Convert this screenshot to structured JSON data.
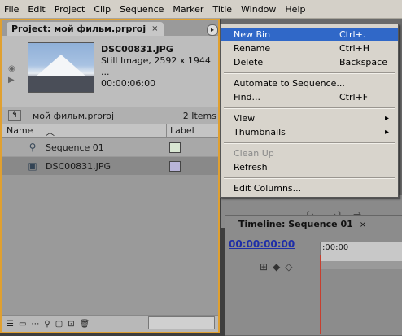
{
  "menubar": [
    "File",
    "Edit",
    "Project",
    "Clip",
    "Sequence",
    "Marker",
    "Title",
    "Window",
    "Help"
  ],
  "project_panel": {
    "tab_title": "Project: мой фильм.prproj",
    "close": "×",
    "preview": {
      "filename": "DSC00831.JPG",
      "line2": "Still Image, 2592 x 1944 ...",
      "duration": "00:00:06:00"
    },
    "path": "мой фильм.prproj",
    "items_count": "2 Items",
    "columns": {
      "name": "Name",
      "label": "Label"
    },
    "items": [
      {
        "name": "Sequence 01",
        "label_color": "#d8e6d2"
      },
      {
        "name": "DSC00831.JPG",
        "label_color": "#b8b4d8"
      }
    ]
  },
  "context_menu": {
    "items": [
      {
        "label": "New Bin",
        "shortcut": "Ctrl+.",
        "highlighted": true
      },
      {
        "label": "Rename",
        "shortcut": "Ctrl+H"
      },
      {
        "label": "Delete",
        "shortcut": "Backspace"
      },
      {
        "label": "Automate to Sequence..."
      },
      {
        "label": "Find...",
        "shortcut": "Ctrl+F"
      },
      {
        "label": "View",
        "submenu": "▸"
      },
      {
        "label": "Thumbnails",
        "submenu": "▸"
      },
      {
        "label": "Clean Up",
        "disabled": true
      },
      {
        "label": "Refresh"
      },
      {
        "label": "Edit Columns..."
      }
    ]
  },
  "timeline": {
    "tab_title": "Timeline: Sequence 01",
    "close": "×",
    "timecode": "00:00:00:00",
    "ruler_start": ":00:00"
  },
  "colors": {
    "panel_focus_border": "#e0a030",
    "menu_highlight": "#3068c8",
    "playhead": "#c63e2e",
    "timecode": "#1e2ea8"
  }
}
